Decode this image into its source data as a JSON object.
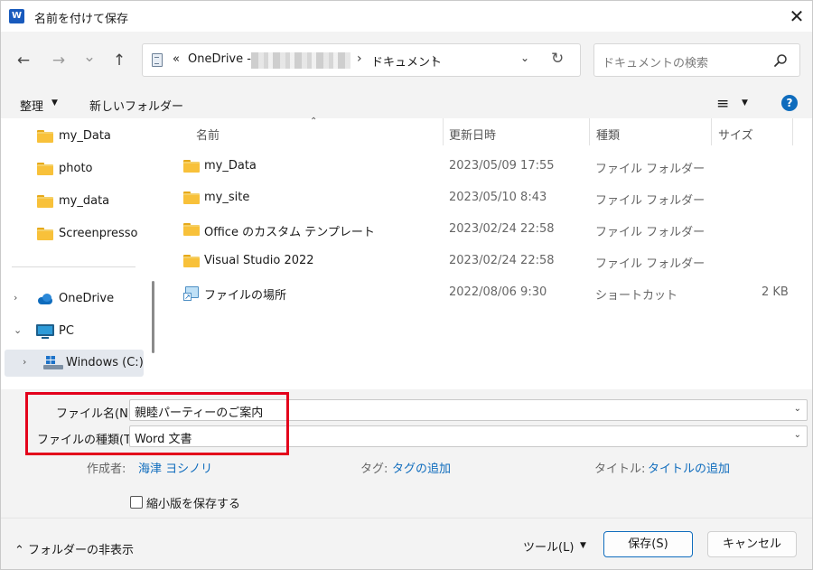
{
  "window": {
    "title": "名前を付けて保存",
    "app_icon": "W",
    "close_glyph": "✕"
  },
  "nav": {
    "back_glyph": "←",
    "forward_glyph": "→",
    "recent_glyph": "⌄",
    "up_glyph": "↑"
  },
  "address": {
    "overflow": "«",
    "root": "OneDrive -",
    "sep": "›",
    "folder": "ドキュメント",
    "sep2": "›",
    "dropdown_glyph": "⌄",
    "refresh_glyph": "↻"
  },
  "search": {
    "placeholder": "ドキュメントの検索"
  },
  "toolbar": {
    "organize": "整理",
    "organize_arrow": "▼",
    "new_folder": "新しいフォルダー",
    "view_glyph": "≡",
    "view_arrow": "▼",
    "help_glyph": "?"
  },
  "sidebar": {
    "quick": [
      {
        "label": "my_Data",
        "icon": "folder-icon"
      },
      {
        "label": "photo",
        "icon": "folder-icon"
      },
      {
        "label": "my_data",
        "icon": "folder-icon"
      },
      {
        "label": "Screenpresso",
        "icon": "folder-icon"
      }
    ],
    "tree": [
      {
        "label": "OneDrive",
        "icon": "cloud-icon",
        "expander": "›"
      },
      {
        "label": "PC",
        "icon": "pc-icon",
        "expander": "⌄"
      },
      {
        "label": "Windows (C:)",
        "icon": "drive-icon",
        "expander": "›"
      }
    ]
  },
  "file_list": {
    "sort_glyph": "⌃",
    "columns": {
      "name": "名前",
      "modified": "更新日時",
      "type": "種類",
      "size": "サイズ"
    },
    "rows": [
      {
        "name": "my_Data",
        "modified": "2023/05/09 17:55",
        "type": "ファイル フォルダー",
        "size": "",
        "icon": "folder-icon"
      },
      {
        "name": "my_site",
        "modified": "2023/05/10 8:43",
        "type": "ファイル フォルダー",
        "size": "",
        "icon": "folder-icon"
      },
      {
        "name": "Office のカスタム テンプレート",
        "modified": "2023/02/24 22:58",
        "type": "ファイル フォルダー",
        "size": "",
        "icon": "folder-icon"
      },
      {
        "name": "Visual Studio 2022",
        "modified": "2023/02/24 22:58",
        "type": "ファイル フォルダー",
        "size": "",
        "icon": "folder-icon"
      },
      {
        "name": "ファイルの場所",
        "modified": "2022/08/06 9:30",
        "type": "ショートカット",
        "size": "2 KB",
        "icon": "shortcut-icon"
      }
    ]
  },
  "form": {
    "filename_label": "ファイル名(N):",
    "filename_value": "親睦パーティーのご案内",
    "filetype_label": "ファイルの種類(T):",
    "filetype_value": "Word 文書",
    "dropdown_glyph": "⌄",
    "author_label": "作成者:",
    "author_value": "海津 ヨシノリ",
    "tags_label": "タグ:",
    "tags_value": "タグの追加",
    "title_label": "タイトル:",
    "title_value": "タイトルの追加",
    "thumbnail_label": "縮小版を保存する",
    "thumbnail_checked": false
  },
  "footer": {
    "hide_folders": "⌃ フォルダーの非表示",
    "tools": "ツール(L)",
    "tools_arrow": "▼",
    "save": "保存(S)",
    "cancel": "キャンセル"
  },
  "colors": {
    "accent": "#0f6cbd",
    "highlight_box": "#e3001b",
    "folder": "#f8c13a"
  }
}
